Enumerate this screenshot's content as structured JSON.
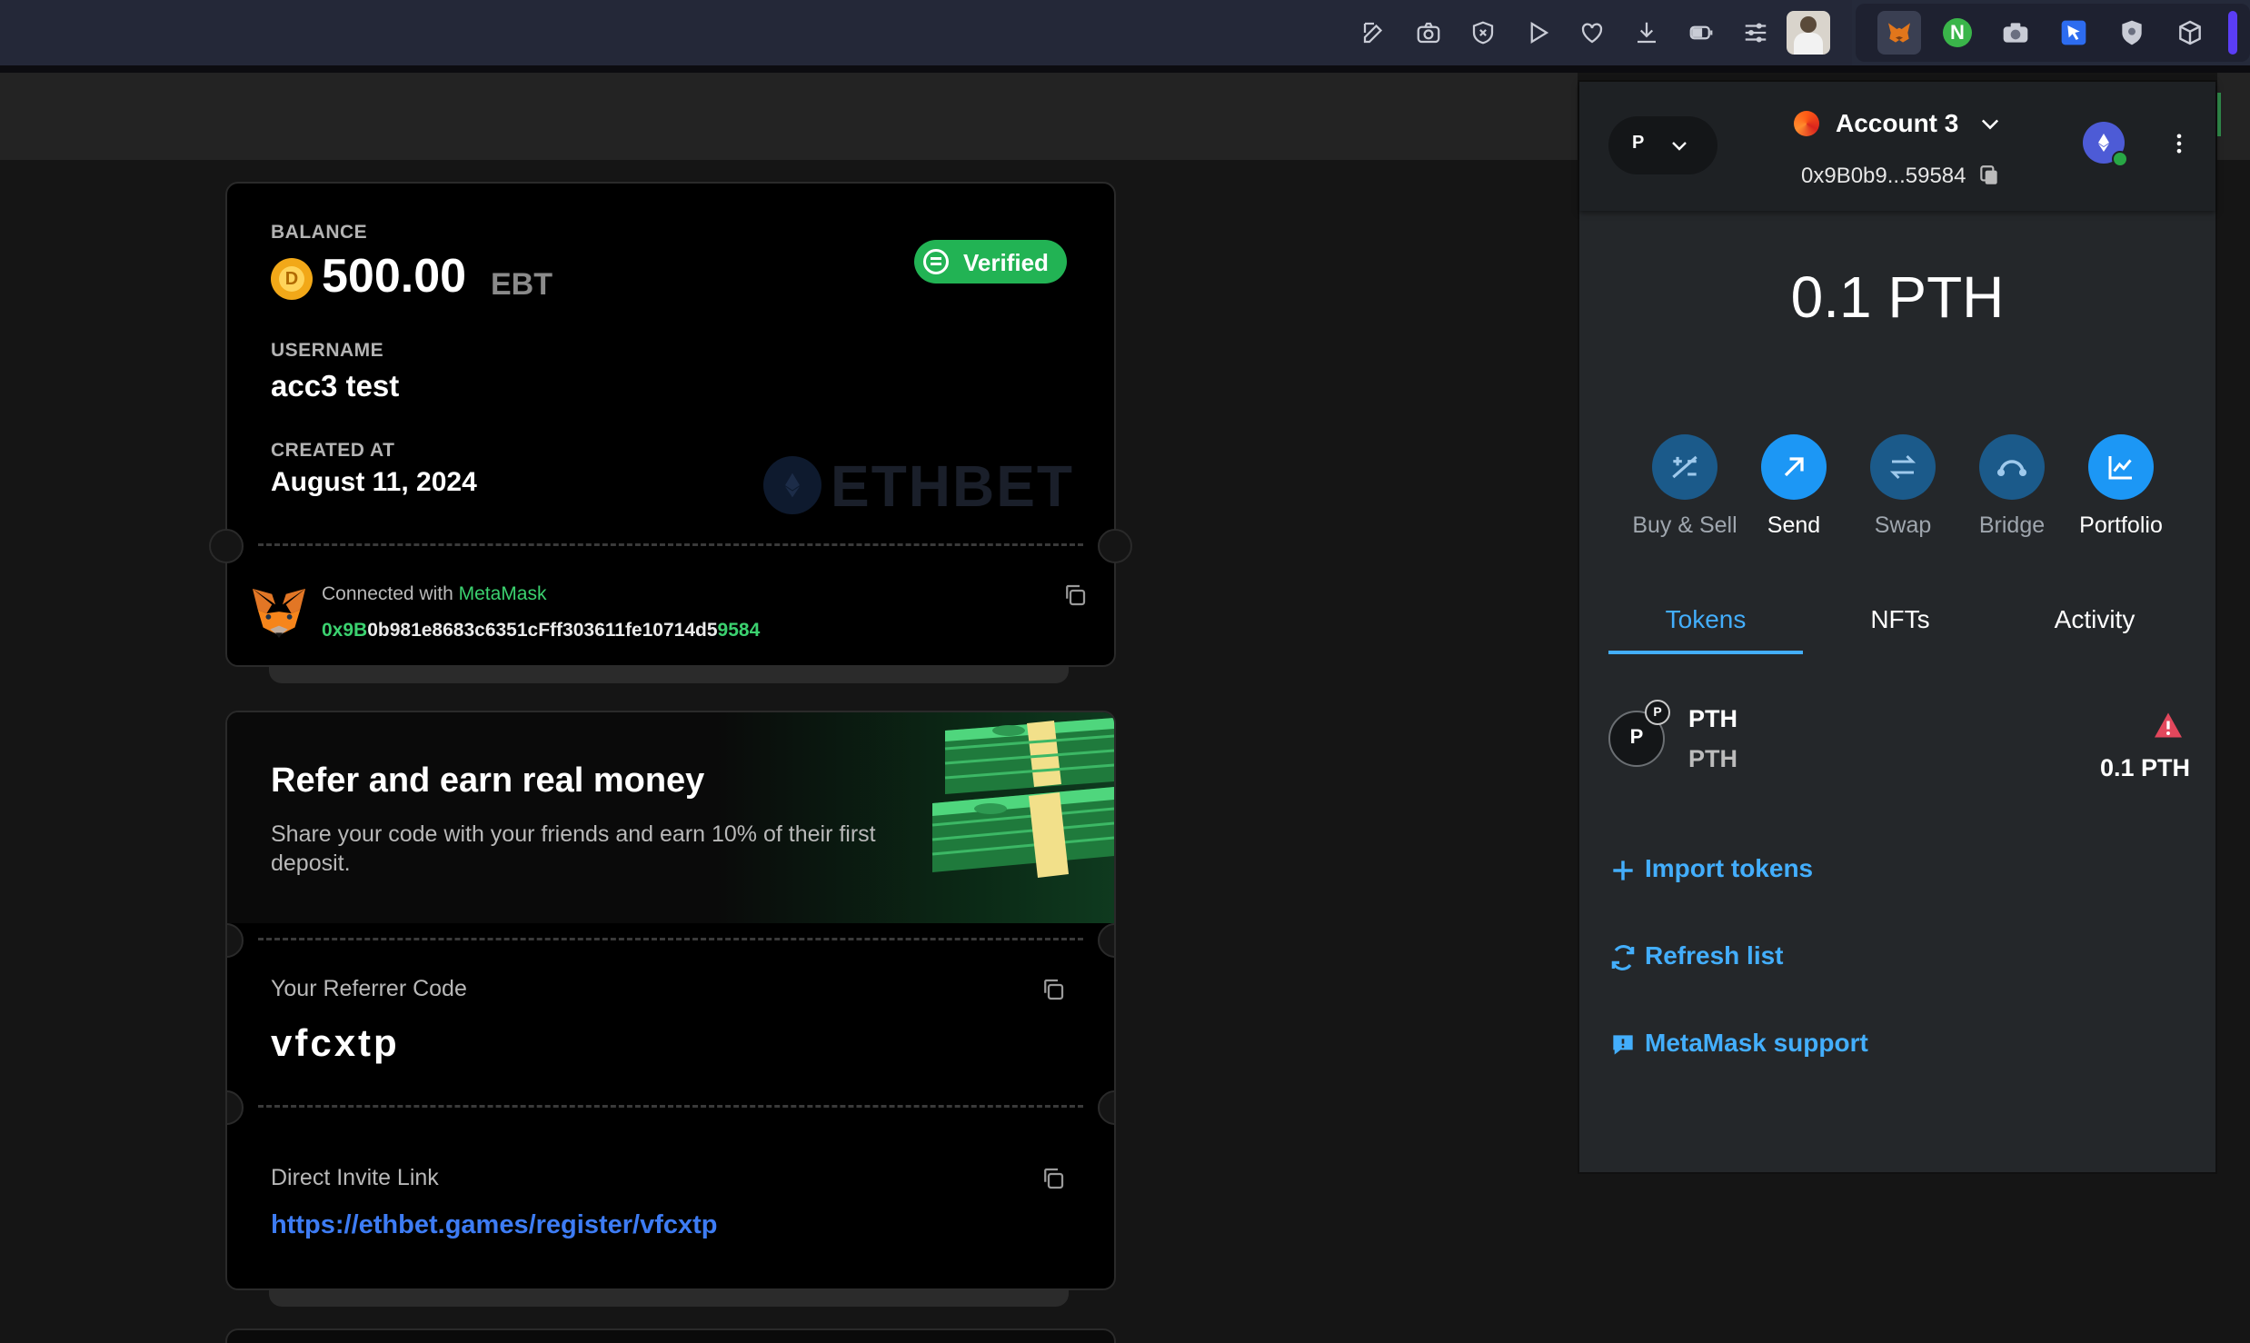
{
  "browser": {
    "toolbar_icons": [
      "edit-icon",
      "camera-icon",
      "shield-x-icon",
      "play-icon",
      "heart-icon",
      "download-icon",
      "battery-icon",
      "sliders-icon",
      "profile-avatar"
    ],
    "extension_icons": [
      "metamask-fox-icon",
      "n-extension-icon",
      "camera-extension-icon",
      "cursor-extension-icon",
      "shield-extension-icon",
      "cube-extension-icon"
    ]
  },
  "balance_card": {
    "balance_label": "BALANCE",
    "balance_value": "500.00",
    "balance_currency": "EBT",
    "verified_label": "Verified",
    "username_label": "USERNAME",
    "username_value": "acc3 test",
    "created_label": "CREATED AT",
    "created_value": "August 11, 2024",
    "watermark": "ETHBET",
    "connected_prefix": "Connected with ",
    "connected_wallet": "MetaMask",
    "address_start": "0x9B",
    "address_middle": "0b981e8683c6351cFff303611fe10714d5",
    "address_end": "9584"
  },
  "refer_card": {
    "title": "Refer and earn real money",
    "description": "Share your code with your friends and earn 10% of their first deposit.",
    "code_label": "Your Referrer Code",
    "code_value": "vfcxtp",
    "link_label": "Direct Invite Link",
    "link_value": "https://ethbet.games/register/vfcxtp"
  },
  "metamask": {
    "network_letter": "P",
    "account_name": "Account 3",
    "account_address": "0x9B0b9...59584",
    "balance": "0.1 PTH",
    "actions": [
      {
        "label": "Buy & Sell",
        "icon": "plus-minus-icon"
      },
      {
        "label": "Send",
        "icon": "arrow-up-right-icon"
      },
      {
        "label": "Swap",
        "icon": "swap-arrows-icon"
      },
      {
        "label": "Bridge",
        "icon": "bridge-icon"
      },
      {
        "label": "Portfolio",
        "icon": "chart-line-icon"
      }
    ],
    "tabs": [
      "Tokens",
      "NFTs",
      "Activity"
    ],
    "active_tab": "Tokens",
    "token": {
      "avatar_letter": "P",
      "badge_letter": "P",
      "name": "PTH",
      "symbol": "PTH",
      "amount": "0.1 PTH"
    },
    "import_tokens": "Import tokens",
    "refresh_list": "Refresh list",
    "support": "MetaMask support"
  },
  "colors": {
    "accent_green": "#3bd16f",
    "metamask_blue": "#43aefc",
    "link_blue": "#3d7cf4",
    "warning_red": "#e2475c"
  }
}
